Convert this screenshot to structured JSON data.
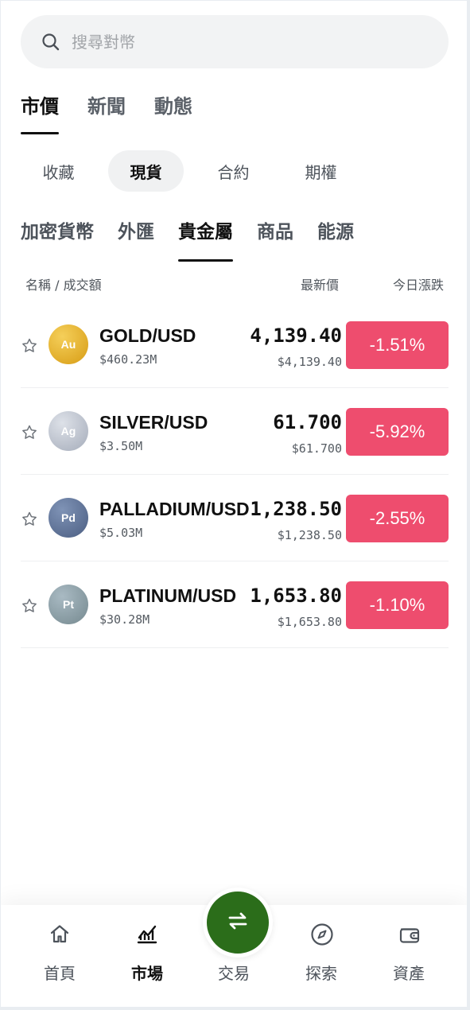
{
  "search": {
    "placeholder": "搜尋對幣",
    "icon": "search-icon"
  },
  "top_tabs": [
    {
      "label": "市價",
      "active": true
    },
    {
      "label": "新聞",
      "active": false
    },
    {
      "label": "動態",
      "active": false
    }
  ],
  "segment_tabs": [
    {
      "label": "收藏",
      "active": false
    },
    {
      "label": "現貨",
      "active": true
    },
    {
      "label": "合約",
      "active": false
    },
    {
      "label": "期權",
      "active": false
    }
  ],
  "category_tabs": [
    {
      "label": "加密貨幣",
      "active": false
    },
    {
      "label": "外匯",
      "active": false
    },
    {
      "label": "貴金屬",
      "active": true
    },
    {
      "label": "商品",
      "active": false
    },
    {
      "label": "能源",
      "active": false
    }
  ],
  "columns": {
    "name": "名稱 / 成交額",
    "price": "最新價",
    "change": "今日漲跌"
  },
  "rows": [
    {
      "symbol": "Au",
      "pair": "GOLD/USD",
      "volume": "$460.23M",
      "price": "4,139.40",
      "price_usd": "$4,139.40",
      "change": "-1.51%",
      "coin_color": "#e6ad26"
    },
    {
      "symbol": "Ag",
      "pair": "SILVER/USD",
      "volume": "$3.50M",
      "price": "61.700",
      "price_usd": "$61.700",
      "change": "-5.92%",
      "coin_color": "#b6bcc8"
    },
    {
      "symbol": "Pd",
      "pair": "PALLADIUM/USD",
      "volume": "$5.03M",
      "price": "1,238.50",
      "price_usd": "$1,238.50",
      "change": "-2.55%",
      "coin_color": "#5f749a"
    },
    {
      "symbol": "Pt",
      "pair": "PLATINUM/USD",
      "volume": "$30.28M",
      "price": "1,653.80",
      "price_usd": "$1,653.80",
      "change": "-1.10%",
      "coin_color": "#8a9ea9"
    }
  ],
  "colors": {
    "down": "#ee4d6e",
    "trade": "#2b6d1a",
    "search_bg": "#f2f3f4"
  },
  "bottom_nav": {
    "home": {
      "label": "首頁",
      "icon": "home-icon"
    },
    "market": {
      "label": "市場",
      "icon": "market-chart-icon",
      "active": true
    },
    "trade": {
      "label": "交易",
      "icon": "swap-arrows-icon"
    },
    "explore": {
      "label": "探索",
      "icon": "compass-icon"
    },
    "assets": {
      "label": "資產",
      "icon": "wallet-icon"
    }
  }
}
